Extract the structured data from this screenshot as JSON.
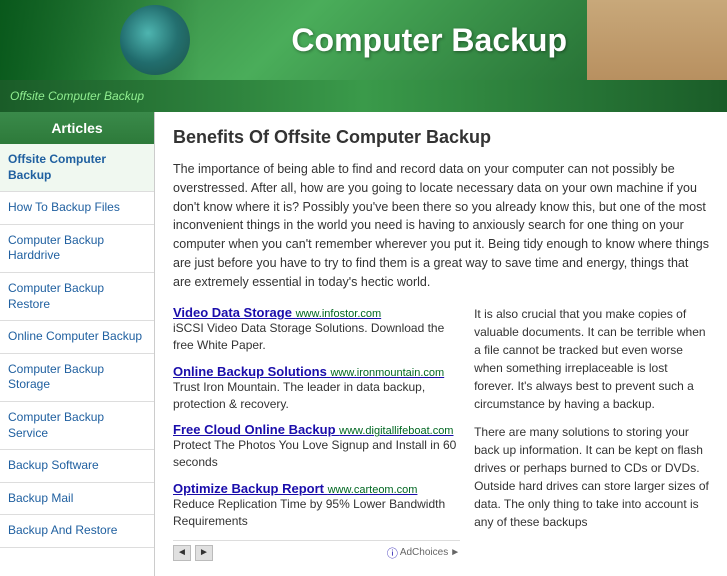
{
  "header": {
    "title": "Computer Backup",
    "banner_text": "Offsite Computer Backup"
  },
  "sidebar": {
    "title": "Articles",
    "items": [
      {
        "label": "Offsite Computer Backup",
        "active": true
      },
      {
        "label": "How To Backup Files",
        "active": false
      },
      {
        "label": "Computer Backup Harddrive",
        "active": false
      },
      {
        "label": "Computer Backup Restore",
        "active": false
      },
      {
        "label": "Online Computer Backup",
        "active": false
      },
      {
        "label": "Computer Backup Storage",
        "active": false
      },
      {
        "label": "Computer Backup Service",
        "active": false
      },
      {
        "label": "Backup Software",
        "active": false
      },
      {
        "label": "Backup Mail",
        "active": false
      },
      {
        "label": "Backup And Restore",
        "active": false
      }
    ]
  },
  "main": {
    "title": "Benefits Of Offsite Computer Backup",
    "intro": "The importance of being able to find and record data on your computer can not possibly be overstressed. After all, how are you going to locate necessary data on your own machine if you don't know where it is? Possibly you've been there so you already know this, but one of the most inconvenient things in the world you need is having to anxiously search for one thing on your computer when you can't remember wherever you put it. Being tidy enough to know where things are just before you have to try to find them is a great way to save time and energy, things that are extremely essential in today's hectic world.",
    "col_right": "It is also crucial that you make copies of valuable documents. It can be terrible when a file cannot be tracked but even worse when something irreplaceable is lost forever. It's always best to prevent such a circumstance by having a backup.\n\nThere are many solutions to storing your back up information. It can be kept on flash drives or perhaps burned to CDs or DVDs. Outside hard drives can store larger sizes of data. The only thing to take into account is any of these backups",
    "ads": [
      {
        "title": "Video Data Storage",
        "domain": "www.infostor.com",
        "description": "iSCSI Video Data Storage Solutions. Download the free White Paper."
      },
      {
        "title": "Online Backup Solutions",
        "domain": "www.ironmountain.com",
        "description": "Trust Iron Mountain. The leader in data backup, protection & recovery."
      },
      {
        "title": "Free Cloud Online Backup",
        "domain": "www.digitallifeboat.com",
        "description": "Protect The Photos You Love Signup and Install in 60 seconds"
      },
      {
        "title": "Optimize Backup Report",
        "domain": "www.carteom.com",
        "description": "Reduce Replication Time by 95% Lower Bandwidth Requirements"
      }
    ],
    "adchoices_label": "AdChoices",
    "arrow_prev": "◄",
    "arrow_next": "►"
  }
}
